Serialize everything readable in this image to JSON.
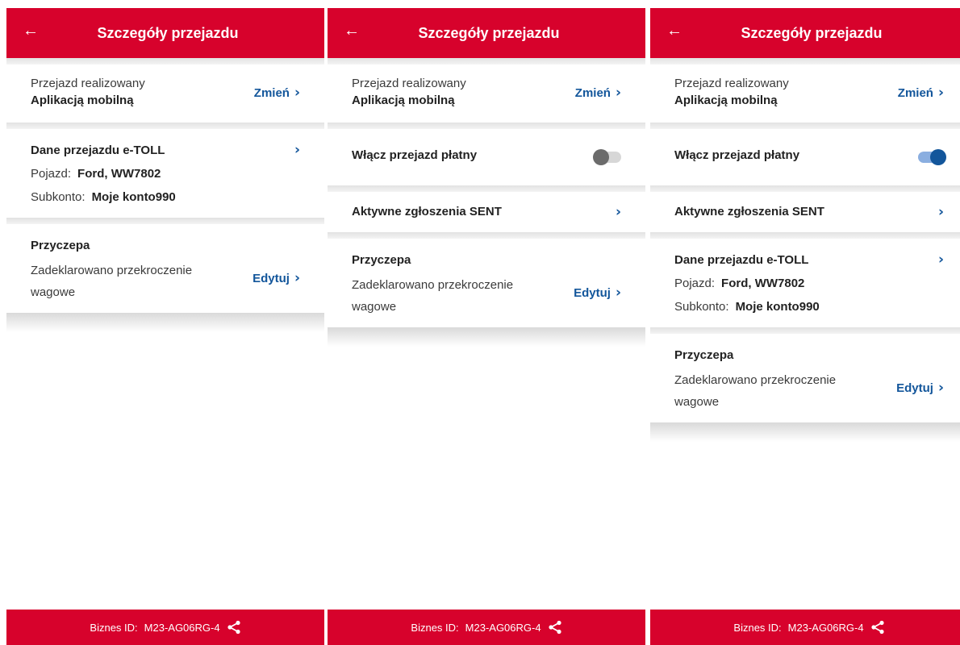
{
  "screens": [
    {
      "header": {
        "title": "Szczegóły przejazdu"
      },
      "mode": {
        "label": "Przejazd realizowany",
        "value": "Aplikacją mobilną",
        "change_label": "Zmień"
      },
      "toll": {
        "title": "Dane przejazdu e-TOLL",
        "vehicle_label": "Pojazd:",
        "vehicle_value": "Ford, WW7802",
        "subaccount_label": "Subkonto:",
        "subaccount_value": "Moje konto990"
      },
      "trailer": {
        "title": "Przyczepa",
        "description": "Zadeklarowano przekroczenie wagowe",
        "edit_label": "Edytuj"
      },
      "footer": {
        "label": "Biznes ID:",
        "value": "M23-AG06RG-4"
      }
    },
    {
      "header": {
        "title": "Szczegóły przejazdu"
      },
      "mode": {
        "label": "Przejazd realizowany",
        "value": "Aplikacją mobilną",
        "change_label": "Zmień"
      },
      "toggle": {
        "label": "Włącz przejazd płatny",
        "state": "off"
      },
      "sent": {
        "label": "Aktywne zgłoszenia SENT"
      },
      "trailer": {
        "title": "Przyczepa",
        "description": "Zadeklarowano przekroczenie wagowe",
        "edit_label": "Edytuj"
      },
      "footer": {
        "label": "Biznes ID:",
        "value": "M23-AG06RG-4"
      }
    },
    {
      "header": {
        "title": "Szczegóły przejazdu"
      },
      "mode": {
        "label": "Przejazd realizowany",
        "value": "Aplikacją mobilną",
        "change_label": "Zmień"
      },
      "toggle": {
        "label": "Włącz przejazd płatny",
        "state": "on"
      },
      "sent": {
        "label": "Aktywne zgłoszenia SENT"
      },
      "toll": {
        "title": "Dane przejazdu e-TOLL",
        "vehicle_label": "Pojazd:",
        "vehicle_value": "Ford, WW7802",
        "subaccount_label": "Subkonto:",
        "subaccount_value": "Moje konto990"
      },
      "trailer": {
        "title": "Przyczepa",
        "description": "Zadeklarowano przekroczenie wagowe",
        "edit_label": "Edytuj"
      },
      "footer": {
        "label": "Biznes ID:",
        "value": "M23-AG06RG-4"
      }
    }
  ],
  "colors": {
    "brand_red": "#d7022c",
    "link_blue": "#13569b",
    "toggle_off": "#6b6b6b",
    "toggle_on": "#13569b"
  },
  "icons": {
    "back": "arrow-left-icon",
    "chevron": "chevron-right-icon",
    "share": "share-icon"
  }
}
